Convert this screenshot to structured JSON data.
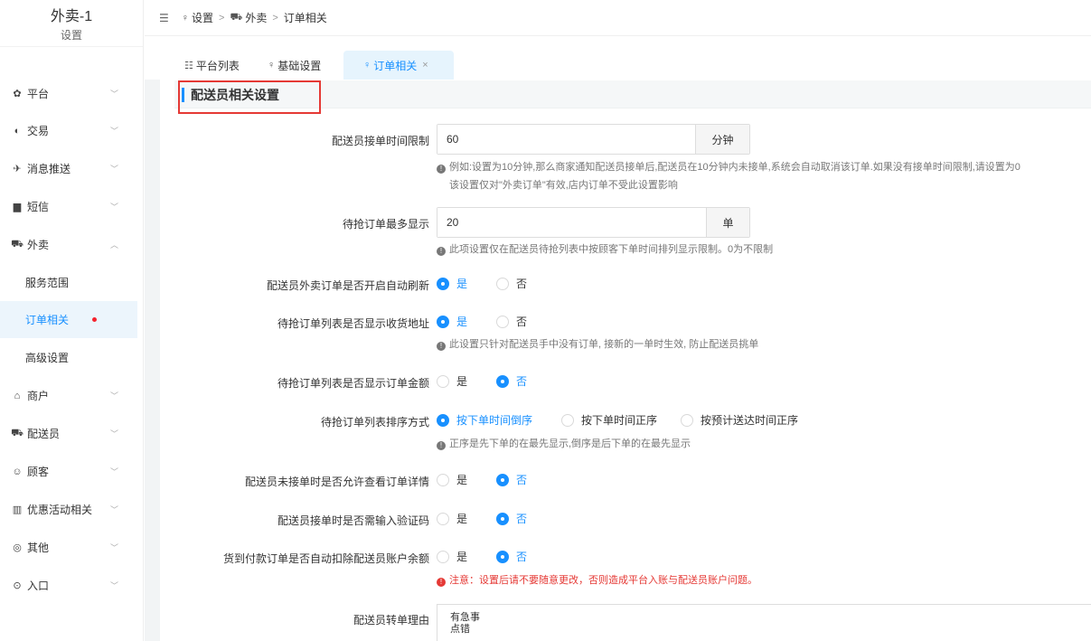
{
  "sidebar": {
    "title": "外卖-1",
    "subtitle": "设置",
    "items": [
      {
        "icon": "gear-icon",
        "label": "平台",
        "chevron": "﹀"
      },
      {
        "icon": "exchange-icon",
        "label": "交易",
        "chevron": "﹀"
      },
      {
        "icon": "message-push-icon",
        "label": "消息推送",
        "chevron": "﹀"
      },
      {
        "icon": "sms-icon",
        "label": "短信",
        "chevron": "﹀"
      },
      {
        "icon": "delivery-icon",
        "label": "外卖",
        "chevron": "︿"
      },
      {
        "label": "服务范围"
      },
      {
        "label": "订单相关"
      },
      {
        "label": "高级设置"
      },
      {
        "icon": "shop-icon",
        "label": "商户",
        "chevron": "﹀"
      },
      {
        "icon": "rider-icon",
        "label": "配送员",
        "chevron": "﹀"
      },
      {
        "icon": "customer-icon",
        "label": "顾客",
        "chevron": "﹀"
      },
      {
        "icon": "gift-icon",
        "label": "优惠活动相关",
        "chevron": "﹀"
      },
      {
        "icon": "other-icon",
        "label": "其他",
        "chevron": "﹀"
      },
      {
        "icon": "entry-icon",
        "label": "入口",
        "chevron": "﹀"
      }
    ]
  },
  "breadcrumb": {
    "items": [
      "设置",
      "外卖",
      "订单相关"
    ],
    "separator": ">"
  },
  "tabs": [
    {
      "label": "平台列表",
      "icon": "list-icon"
    },
    {
      "label": "基础设置",
      "icon": "settings-icon"
    },
    {
      "label": "订单相关",
      "icon": "settings-icon",
      "close": "×"
    }
  ],
  "section": {
    "title": "配送员相关设置"
  },
  "fields": {
    "accept_time_limit": {
      "label": "配送员接单时间限制",
      "value": "60",
      "unit": "分钟",
      "help1": "例如:设置为10分钟,那么商家通知配送员接单后,配送员在10分钟内未接单,系统会自动取消该订单.如果没有接单时间限制,请设置为0",
      "help2": "该设置仅对\"外卖订单\"有效,店内订单不受此设置影响"
    },
    "max_display": {
      "label": "待抢订单最多显示",
      "value": "20",
      "unit": "单",
      "help": "此项设置仅在配送员待抢列表中按顾客下单时间排列显示限制。0为不限制"
    },
    "auto_refresh": {
      "label": "配送员外卖订单是否开启自动刷新",
      "options": [
        "是",
        "否"
      ]
    },
    "show_address": {
      "label": "待抢订单列表是否显示收货地址",
      "options": [
        "是",
        "否"
      ],
      "help": "此设置只针对配送员手中没有订单, 接新的一单时生效, 防止配送员挑单"
    },
    "show_amount": {
      "label": "待抢订单列表是否显示订单金额",
      "options": [
        "是",
        "否"
      ]
    },
    "sort_method": {
      "label": "待抢订单列表排序方式",
      "options": [
        "按下单时间倒序",
        "按下单时间正序",
        "按预计送达时间正序"
      ],
      "help": "正序是先下单的在最先显示,倒序是后下单的在最先显示"
    },
    "view_detail": {
      "label": "配送员未接单时是否允许查看订单详情",
      "options": [
        "是",
        "否"
      ]
    },
    "verify_code": {
      "label": "配送员接单时是否需输入验证码",
      "options": [
        "是",
        "否"
      ]
    },
    "cod_deduct": {
      "label": "货到付款订单是否自动扣除配送员账户余额",
      "options": [
        "是",
        "否"
      ],
      "warning": "注意：设置后请不要随意更改，否则造成平台入账与配送员账户问题。"
    },
    "transfer_reason": {
      "label": "配送员转单理由",
      "lines": [
        "有急事",
        "点错"
      ]
    }
  },
  "colors": {
    "accent": "#1890ff",
    "warning": "#e53935",
    "active_bg": "#e6f4fd"
  }
}
